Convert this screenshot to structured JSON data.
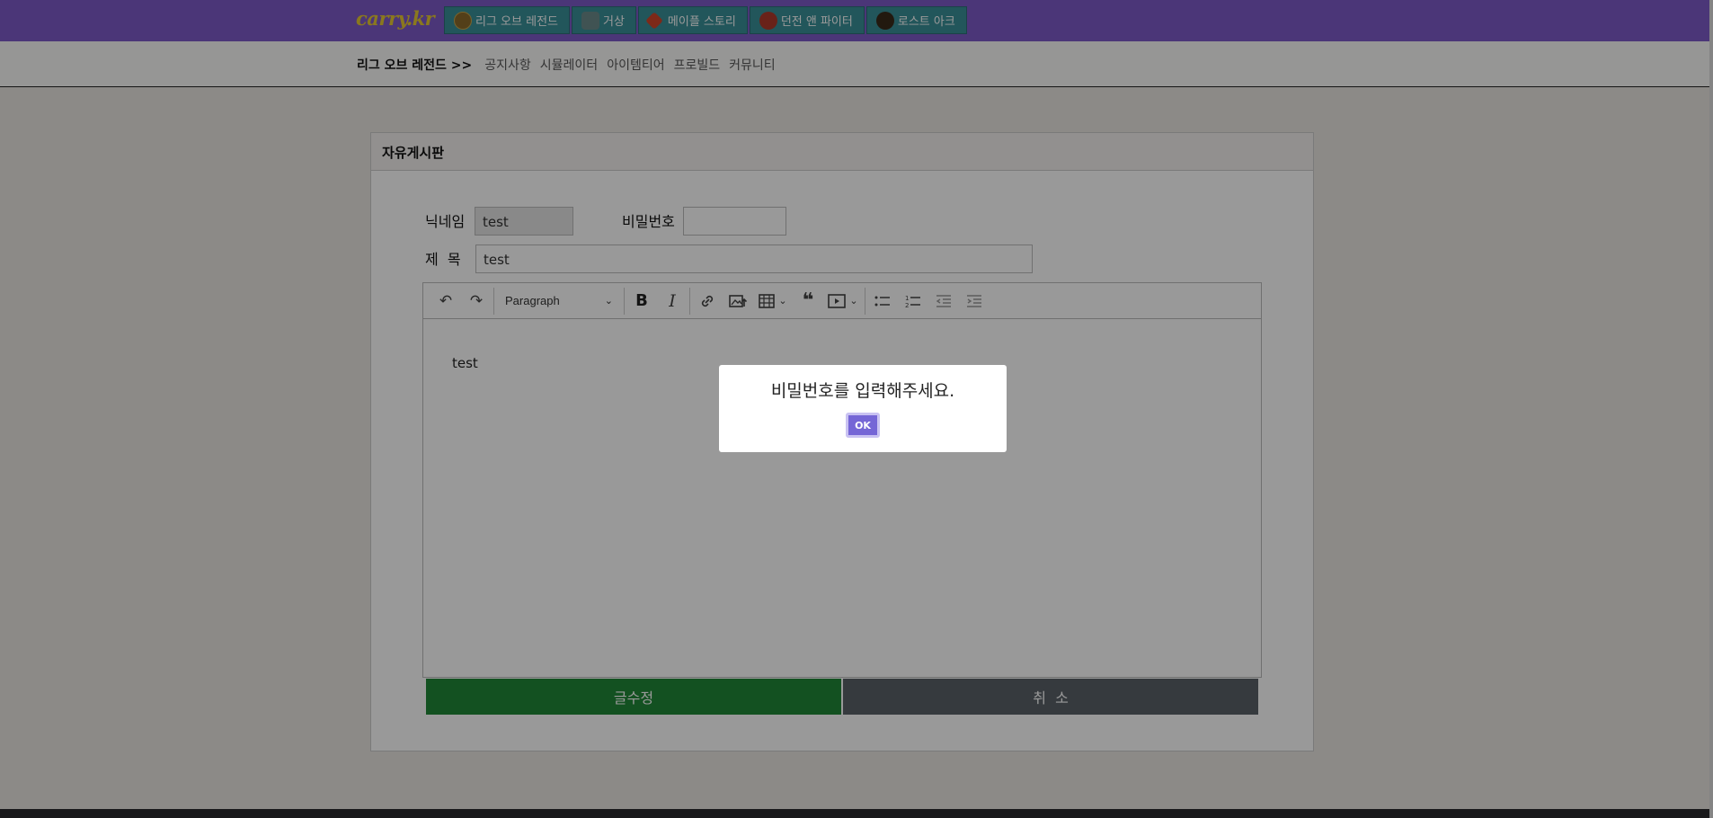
{
  "logo": "carry.kr",
  "game_tabs": [
    {
      "label": "리그 오브 레전드",
      "icon": "lol-icon",
      "color": "#8a6a2a"
    },
    {
      "label": "거상",
      "icon": "geosang-icon",
      "color": "#5a7a6a"
    },
    {
      "label": "메이플 스토리",
      "icon": "maple-leaf-icon",
      "color": "#d0452a"
    },
    {
      "label": "던전 앤 파이터",
      "icon": "dnf-icon",
      "color": "#b03a2a"
    },
    {
      "label": "로스트 아크",
      "icon": "lostark-icon",
      "color": "#5a3a1a"
    }
  ],
  "subnav": {
    "section": "리그 오브 레전드 >>",
    "links": [
      "공지사항",
      "시뮬레이터",
      "아이템티어",
      "프로빌드",
      "커뮤니티"
    ]
  },
  "board": {
    "title": "자유게시판",
    "nickname_label": "닉네임",
    "nickname_value": "test",
    "password_label": "비밀번호",
    "password_value": "",
    "subject_label": "제  목",
    "subject_value": "test",
    "editor": {
      "heading_select": "Paragraph",
      "content": "test",
      "tools": [
        "undo-icon",
        "redo-icon",
        "bold-icon",
        "italic-icon",
        "link-icon",
        "image-upload-icon",
        "table-icon",
        "blockquote-icon",
        "media-icon",
        "bullet-list-icon",
        "numbered-list-icon",
        "outdent-icon",
        "indent-icon"
      ]
    },
    "submit_label": "글수정",
    "cancel_label": "취  소"
  },
  "dialog": {
    "message": "비밀번호를 입력해주세요.",
    "ok_label": "OK"
  },
  "colors": {
    "topbar": "#7e5bc8",
    "tab": "#3a8f98",
    "submit": "#218838",
    "cancel": "#5a6268",
    "ok": "#7566d6"
  }
}
